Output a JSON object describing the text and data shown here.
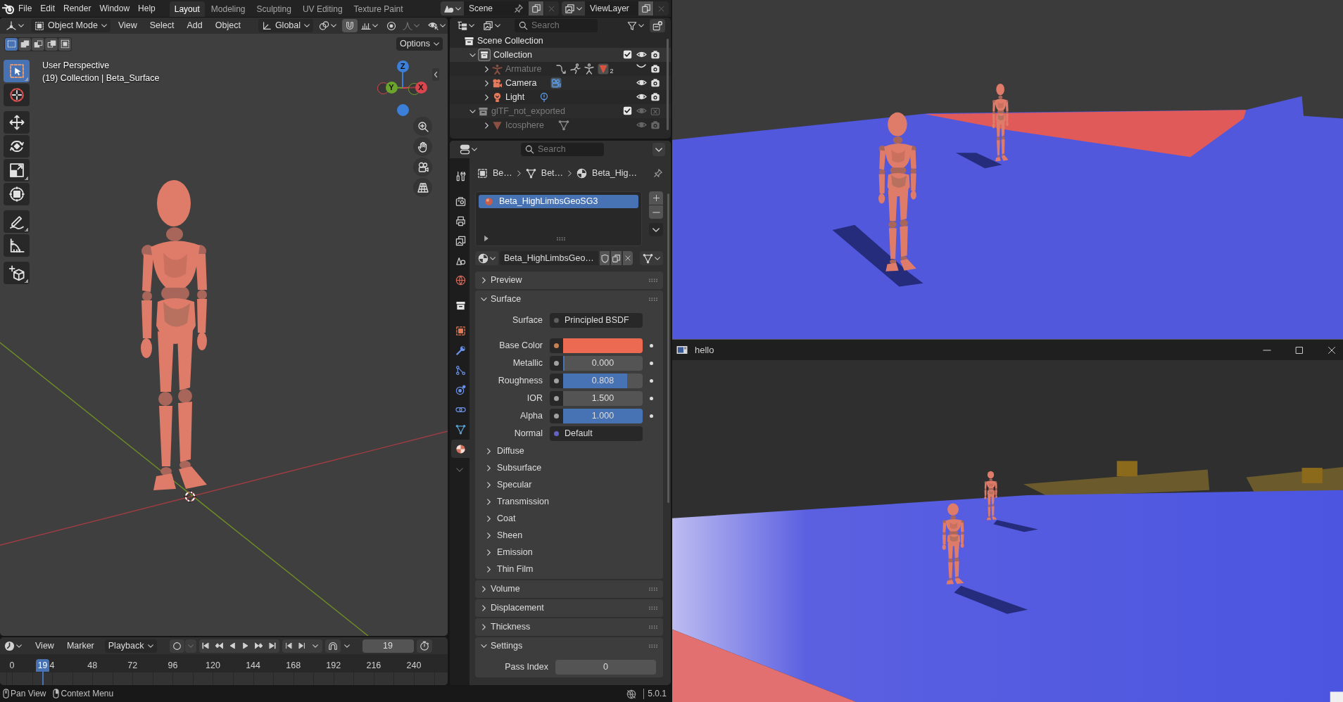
{
  "topbar": {
    "menus": [
      "File",
      "Edit",
      "Render",
      "Window",
      "Help"
    ],
    "workspaces": [
      {
        "label": "Layout",
        "selected": true
      },
      {
        "label": "Modeling",
        "selected": false
      },
      {
        "label": "Sculpting",
        "selected": false
      },
      {
        "label": "UV Editing",
        "selected": false
      },
      {
        "label": "Texture Paint",
        "selected": false
      }
    ],
    "scene": "Scene",
    "view_layer": "ViewLayer"
  },
  "viewport": {
    "mode": "Object Mode",
    "menus": [
      "View",
      "Select",
      "Add",
      "Object"
    ],
    "orientation": "Global",
    "select_modes": [
      {
        "kind": "new",
        "selected": true
      },
      {
        "kind": "extend",
        "selected": false
      },
      {
        "kind": "subtract",
        "selected": false
      },
      {
        "kind": "invert",
        "selected": false
      },
      {
        "kind": "intersect",
        "selected": false
      }
    ],
    "options": "Options",
    "tool_groups": [
      [
        {
          "kind": "select_box",
          "selected": true,
          "more": true
        },
        {
          "kind": "cursor",
          "selected": false,
          "more": false
        }
      ],
      [
        {
          "kind": "move",
          "selected": false,
          "more": false
        },
        {
          "kind": "rotate",
          "selected": false,
          "more": false
        },
        {
          "kind": "scale",
          "selected": false,
          "more": true
        },
        {
          "kind": "transform",
          "selected": false,
          "more": false
        }
      ],
      [
        {
          "kind": "annotate",
          "selected": false,
          "more": true
        },
        {
          "kind": "measure",
          "selected": false,
          "more": false
        }
      ],
      [
        {
          "kind": "add_cube",
          "selected": false,
          "more": true
        }
      ]
    ],
    "info": [
      "User Perspective",
      "(19) Collection | Beta_Surface"
    ],
    "gizmo": [
      {
        "label": "Z",
        "color": "#3b7fd9"
      },
      {
        "label": "Y",
        "color": "#6ba32b"
      },
      {
        "label": "X",
        "color": "#d9464d"
      }
    ]
  },
  "timeline": {
    "menus": [
      "View",
      "Marker"
    ],
    "playback": "Playback",
    "frame": "19",
    "playhead": "19",
    "ruler": [
      "0",
      "4",
      "48",
      "72",
      "96",
      "120",
      "144",
      "168",
      "192",
      "216",
      "240"
    ]
  },
  "outliner": {
    "placeholder": "Search",
    "tree": [
      {
        "label": "Scene Collection",
        "kind": "collection",
        "children": [
          {
            "label": "Collection",
            "kind": "collection",
            "expanded": true,
            "active": true,
            "dimmed": false,
            "checked": true,
            "visible": true,
            "renderable": true,
            "toggles_greyed": false,
            "children": [
              {
                "label": "Armature",
                "kind": "armature",
                "expanded": false,
                "active": false,
                "dimmed": true,
                "visible": false,
                "renderable": true,
                "toggles_greyed": false,
                "data": [
                  {
                    "kind": "constraint",
                    "highlighted": false
                  },
                  {
                    "kind": "pose",
                    "highlighted": false
                  },
                  {
                    "kind": "armature_data",
                    "highlighted": false
                  },
                  {
                    "kind": "child_mesh",
                    "highlighted": true,
                    "count": "2"
                  }
                ]
              },
              {
                "label": "Camera",
                "kind": "camera",
                "expanded": false,
                "active": false,
                "dimmed": false,
                "visible": true,
                "renderable": true,
                "toggles_greyed": false,
                "data": [
                  {
                    "kind": "camera_data",
                    "highlighted": true
                  }
                ]
              },
              {
                "label": "Light",
                "kind": "light",
                "expanded": false,
                "active": false,
                "dimmed": false,
                "visible": true,
                "renderable": true,
                "toggles_greyed": false,
                "data": [
                  {
                    "kind": "light_data",
                    "highlighted": false
                  }
                ]
              }
            ]
          },
          {
            "label": "glTF_not_exported",
            "kind": "collection",
            "expanded": true,
            "active": false,
            "dimmed": true,
            "checked": true,
            "visible": true,
            "renderable": false,
            "toggles_greyed": true,
            "children": [
              {
                "label": "Icosphere",
                "kind": "mesh",
                "expanded": false,
                "active": false,
                "dimmed": true,
                "visible": true,
                "renderable": true,
                "toggles_greyed": true,
                "data": [
                  {
                    "kind": "mesh_data",
                    "highlighted": false
                  }
                ]
              }
            ]
          }
        ]
      }
    ]
  },
  "properties": {
    "placeholder": "Search",
    "tab_groups": [
      [
        {
          "kind": "tool",
          "selected": false
        }
      ],
      [
        {
          "kind": "render",
          "selected": false
        },
        {
          "kind": "output",
          "selected": false
        },
        {
          "kind": "view_layer",
          "selected": false
        },
        {
          "kind": "scene",
          "selected": false
        },
        {
          "kind": "world",
          "selected": false
        }
      ],
      [
        {
          "kind": "collection",
          "selected": false
        }
      ],
      [
        {
          "kind": "object",
          "selected": false
        },
        {
          "kind": "modifiers",
          "selected": false
        },
        {
          "kind": "particles",
          "selected": false
        },
        {
          "kind": "physics",
          "selected": false
        },
        {
          "kind": "constraints",
          "selected": false
        },
        {
          "kind": "data",
          "selected": false
        },
        {
          "kind": "material",
          "selected": true
        }
      ]
    ],
    "breadcrumb": [
      {
        "kind": "object",
        "label": "Be…"
      },
      {
        "kind": "mesh",
        "label": "Bet…"
      },
      {
        "kind": "material",
        "label": "Beta_Hig…"
      }
    ],
    "slots": [
      {
        "label": "Beta_HighLimbsGeoSG3",
        "selected": true
      }
    ],
    "material": "Beta_HighLimbsGeo…",
    "panels": [
      {
        "title": "Preview",
        "expanded": false
      },
      {
        "title": "Surface",
        "expanded": true,
        "rows": [
          {
            "kind": "link",
            "label": "Surface",
            "value": "Principled BSDF",
            "socket": {
              "color": "#5e5e5e"
            }
          },
          {
            "kind": "color",
            "label": "Base Color",
            "color": "#ec6a52",
            "socket": {
              "color": "#c7804e"
            }
          },
          {
            "kind": "slider",
            "label": "Metallic",
            "value": "0.000",
            "level": 0,
            "socket": {
              "color": "#a1a1a1"
            }
          },
          {
            "kind": "slider",
            "label": "Roughness",
            "value": "0.808",
            "level": 0.808,
            "socket": {
              "color": "#a1a1a1"
            }
          },
          {
            "kind": "number",
            "label": "IOR",
            "value": "1.500",
            "socket": {
              "color": "#a1a1a1"
            }
          },
          {
            "kind": "slider",
            "label": "Alpha",
            "value": "1.000",
            "level": 1,
            "socket": {
              "color": "#a1a1a1"
            }
          },
          {
            "kind": "link",
            "label": "Normal",
            "value": "Default",
            "socket": {
              "color": "#6363c7"
            }
          }
        ],
        "subpanels": [
          {
            "title": "Diffuse",
            "expanded": false
          },
          {
            "title": "Subsurface",
            "expanded": false
          },
          {
            "title": "Specular",
            "expanded": false
          },
          {
            "title": "Transmission",
            "expanded": false
          },
          {
            "title": "Coat",
            "expanded": false
          },
          {
            "title": "Sheen",
            "expanded": false
          },
          {
            "title": "Emission",
            "expanded": false
          },
          {
            "title": "Thin Film",
            "expanded": false
          }
        ]
      },
      {
        "title": "Volume",
        "expanded": false
      },
      {
        "title": "Displacement",
        "expanded": false
      },
      {
        "title": "Thickness",
        "expanded": false
      },
      {
        "title": "Settings",
        "expanded": true,
        "rows": [
          {
            "kind": "number",
            "label": "Pass Index",
            "value": "0"
          }
        ]
      }
    ]
  },
  "status_bar": {
    "hints": [
      {
        "kind": "mouse_middle",
        "label": "Pan View"
      },
      {
        "kind": "mouse_right",
        "label": "Context Menu"
      }
    ],
    "version": "5.0.1"
  },
  "hello_window": {
    "title": "hello"
  }
}
